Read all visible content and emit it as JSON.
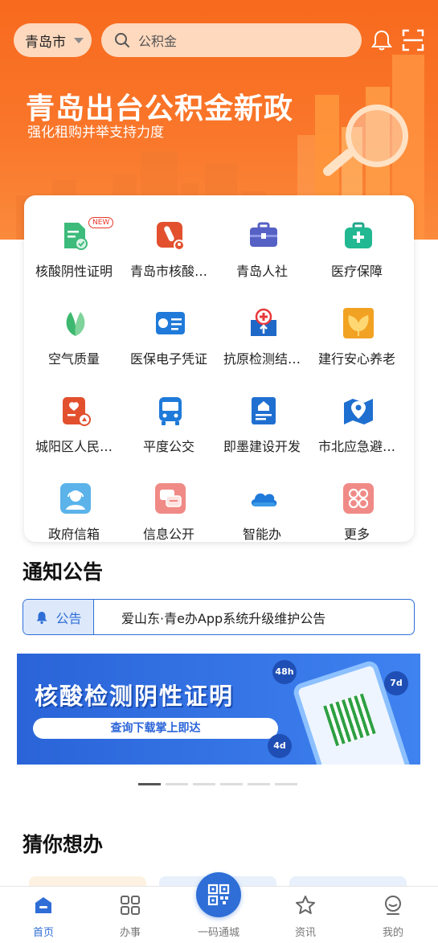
{
  "header": {
    "city": "青岛市",
    "search_placeholder": "公积金"
  },
  "hero": {
    "title": "青岛出台公积金新政",
    "subtitle": "强化租购并举支持力度"
  },
  "services": [
    {
      "label": "核酸阴性证明",
      "icon": "nucleic-certificate-icon",
      "badge": "NEW"
    },
    {
      "label": "青岛市核酸…",
      "icon": "test-tube-location-icon"
    },
    {
      "label": "青岛人社",
      "icon": "briefcase-icon"
    },
    {
      "label": "医疗保障",
      "icon": "medical-kit-icon"
    },
    {
      "label": "空气质量",
      "icon": "leaf-icon"
    },
    {
      "label": "医保电子凭证",
      "icon": "medical-card-icon"
    },
    {
      "label": "抗原检测结…",
      "icon": "antigen-upload-icon"
    },
    {
      "label": "建行安心养老",
      "icon": "ginkgo-icon"
    },
    {
      "label": "城阳区人民…",
      "icon": "hospital-report-icon"
    },
    {
      "label": "平度公交",
      "icon": "bus-icon"
    },
    {
      "label": "即墨建设开发",
      "icon": "building-doc-icon"
    },
    {
      "label": "市北应急避…",
      "icon": "map-pin-icon"
    },
    {
      "label": "政府信箱",
      "icon": "customer-service-icon"
    },
    {
      "label": "信息公开",
      "icon": "chat-bubbles-icon"
    },
    {
      "label": "智能办",
      "icon": "cloud-icon"
    },
    {
      "label": "更多",
      "icon": "more-grid-icon"
    }
  ],
  "notice": {
    "section_title": "通知公告",
    "tag": "公告",
    "text": "爱山东·青e办App系统升级维护公告"
  },
  "banner": {
    "title": "核酸检测阴性证明",
    "subtitle": "查询下载掌上即达",
    "bubbles": [
      "48h",
      "7d",
      "4d"
    ],
    "page_count": 6,
    "active_page": 1
  },
  "guess": {
    "section_title": "猜你想办"
  },
  "tabbar": {
    "items": [
      {
        "label": "首页",
        "icon": "home-icon",
        "active": true
      },
      {
        "label": "办事",
        "icon": "apps-grid-icon",
        "active": false
      },
      {
        "label": "一码通城",
        "icon": "qr-code-icon",
        "active": false
      },
      {
        "label": "资讯",
        "icon": "star-icon",
        "active": false
      },
      {
        "label": "我的",
        "icon": "profile-icon",
        "active": false
      }
    ]
  },
  "colors": {
    "brand_blue": "#2e6ed6",
    "hero_orange": "#f86a1e"
  }
}
